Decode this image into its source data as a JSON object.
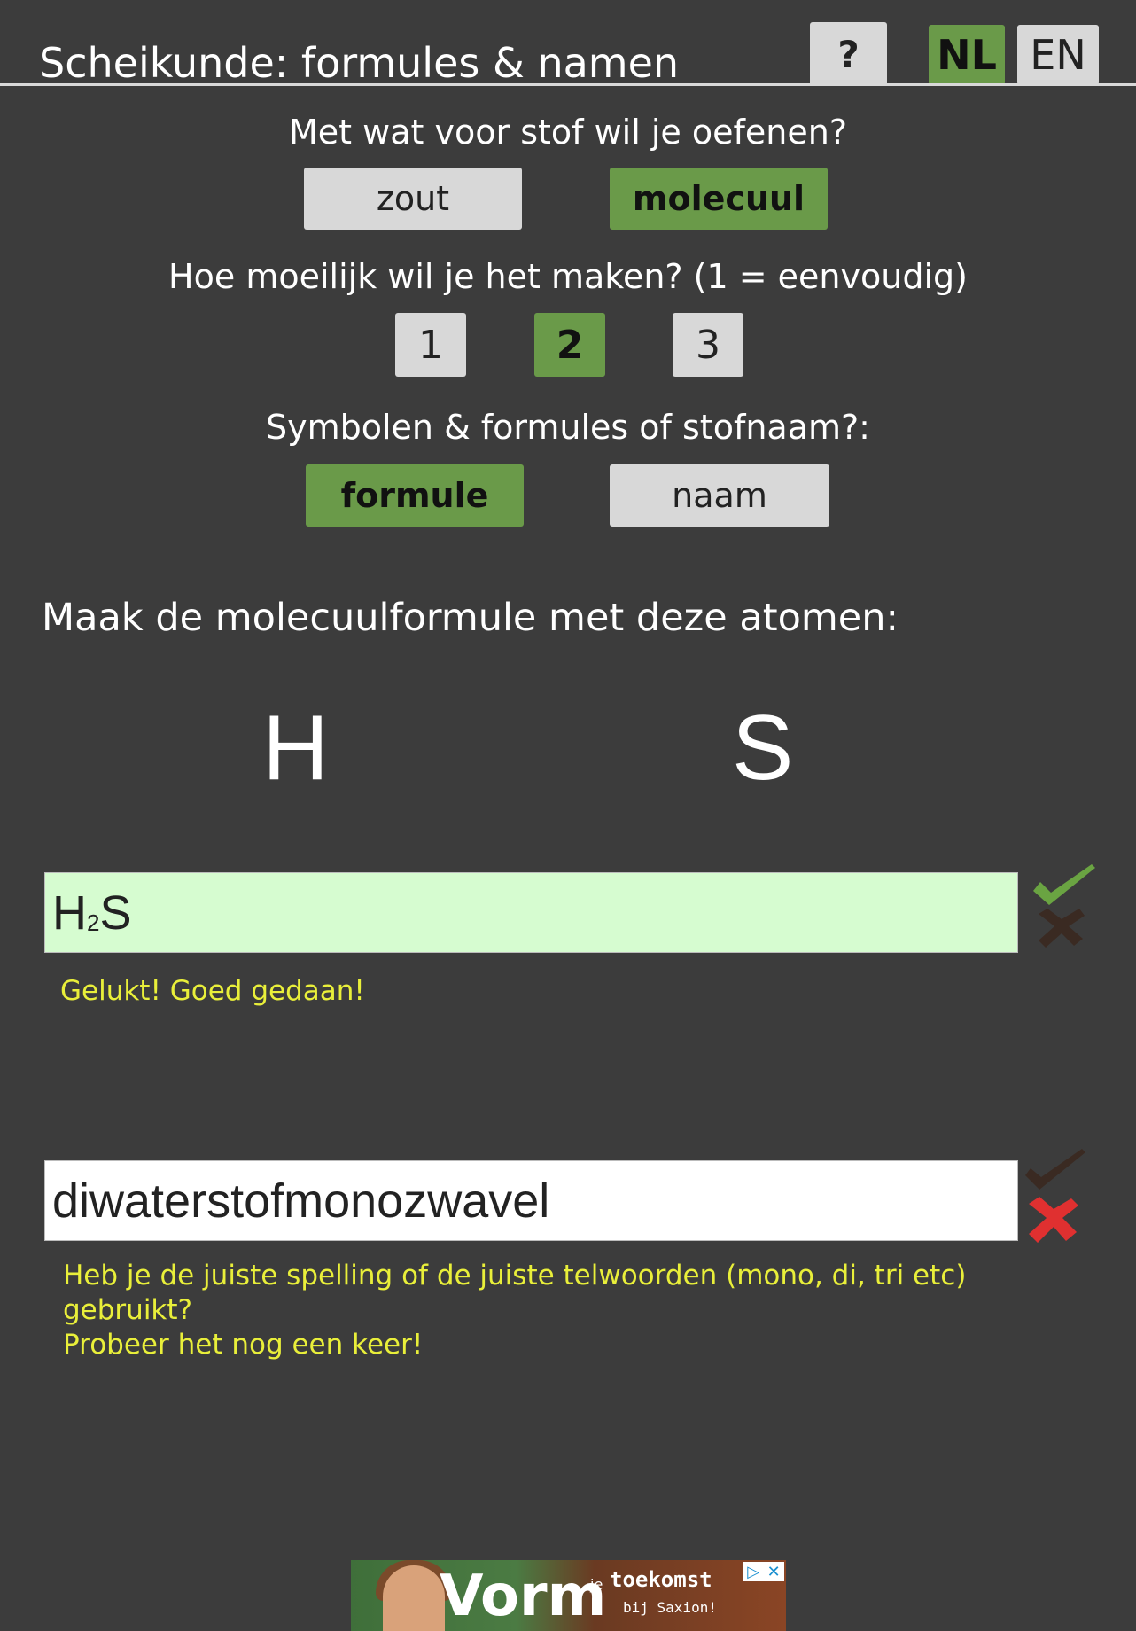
{
  "header": {
    "title": "Scheikunde: formules & namen",
    "help_label": "?",
    "lang_nl": "NL",
    "lang_en": "EN"
  },
  "settings": {
    "substance_question": "Met wat voor stof wil je oefenen?",
    "substance_options": [
      "zout",
      "molecuul"
    ],
    "substance_selected": "molecuul",
    "difficulty_question": "Hoe moeilijk wil je het maken? (1 = eenvoudig)",
    "difficulty_options": [
      "1",
      "2",
      "3"
    ],
    "difficulty_selected": "2",
    "mode_question": "Symbolen & formules of stofnaam?:",
    "mode_options": [
      "formule",
      "naam"
    ],
    "mode_selected": "formule"
  },
  "exercise": {
    "instruction": "Maak de molecuulformule met deze atomen:",
    "atoms": [
      "H",
      "S"
    ]
  },
  "formula_answer": {
    "value_main": "H",
    "value_sub": "2",
    "value_end": "S",
    "status": "correct",
    "feedback": "Gelukt! Goed gedaan!"
  },
  "name_answer": {
    "value": "diwaterstofmonozwavel",
    "status": "incorrect",
    "feedback_line1": "Heb je de juiste spelling of de juiste telwoorden (mono, di, tri etc)",
    "feedback_line2": "gebruikt?",
    "feedback_line3": "Probeer het nog een keer!"
  },
  "ad": {
    "main_text": "Vorm",
    "small_text": "je",
    "line1": "toekomst",
    "line2": "bij Saxion!"
  },
  "colors": {
    "background": "#3c3c3c",
    "selected_green": "#6a9a49",
    "unselected_grey": "#d8d8d8",
    "correct_box": "#d6fcd0",
    "feedback_yellow": "#e9ef3a",
    "check_green": "#6aa442",
    "cross_red": "#e03030"
  }
}
